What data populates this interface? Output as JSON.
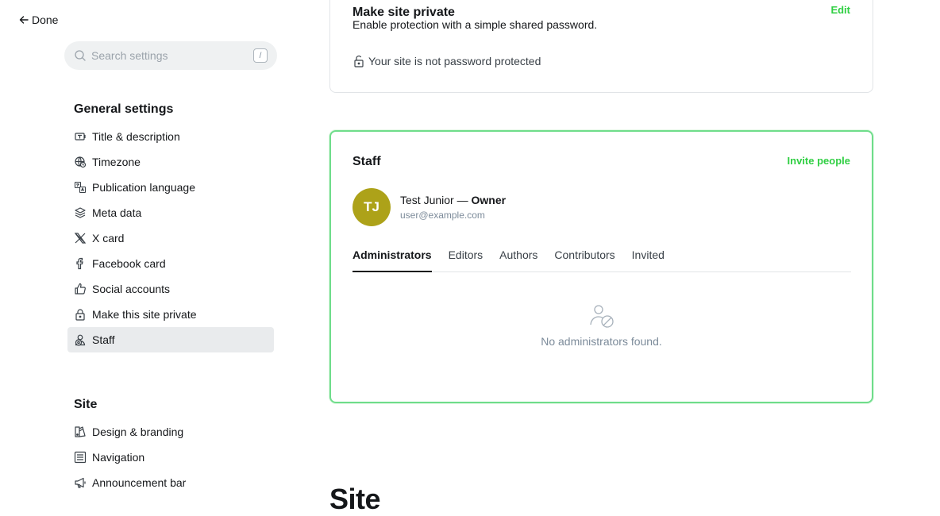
{
  "nav": {
    "done_label": "Done",
    "search": {
      "placeholder": "Search settings",
      "shortcut": "/"
    },
    "general_title": "General settings",
    "general_items": [
      {
        "label": "Title & description",
        "icon": "title-icon"
      },
      {
        "label": "Timezone",
        "icon": "timezone-icon"
      },
      {
        "label": "Publication language",
        "icon": "language-icon"
      },
      {
        "label": "Meta data",
        "icon": "layers-icon"
      },
      {
        "label": "X card",
        "icon": "x-icon"
      },
      {
        "label": "Facebook card",
        "icon": "facebook-icon"
      },
      {
        "label": "Social accounts",
        "icon": "thumbs-up-icon"
      },
      {
        "label": "Make this site private",
        "icon": "lock-icon"
      },
      {
        "label": "Staff",
        "icon": "staff-icon",
        "active": true
      }
    ],
    "site_title": "Site",
    "site_items": [
      {
        "label": "Design & branding",
        "icon": "brush-icon"
      },
      {
        "label": "Navigation",
        "icon": "list-icon"
      },
      {
        "label": "Announcement bar",
        "icon": "megaphone-icon"
      }
    ]
  },
  "private_card": {
    "title": "Make site private",
    "description": "Enable protection with a simple shared password.",
    "edit_label": "Edit",
    "status": "Your site is not password protected"
  },
  "staff_card": {
    "title": "Staff",
    "invite_label": "Invite people",
    "owner": {
      "initials": "TJ",
      "name": "Test Junior",
      "separator": " — ",
      "role": "Owner",
      "email": "user@example.com"
    },
    "tabs": [
      "Administrators",
      "Editors",
      "Authors",
      "Contributors",
      "Invited"
    ],
    "empty_message": "No administrators found."
  },
  "site_heading": "Site",
  "colors": {
    "accent": "#30cf43",
    "avatar": "#ada219",
    "active_nav": "#e9ebed",
    "focus_border": "#6fdd8b"
  }
}
